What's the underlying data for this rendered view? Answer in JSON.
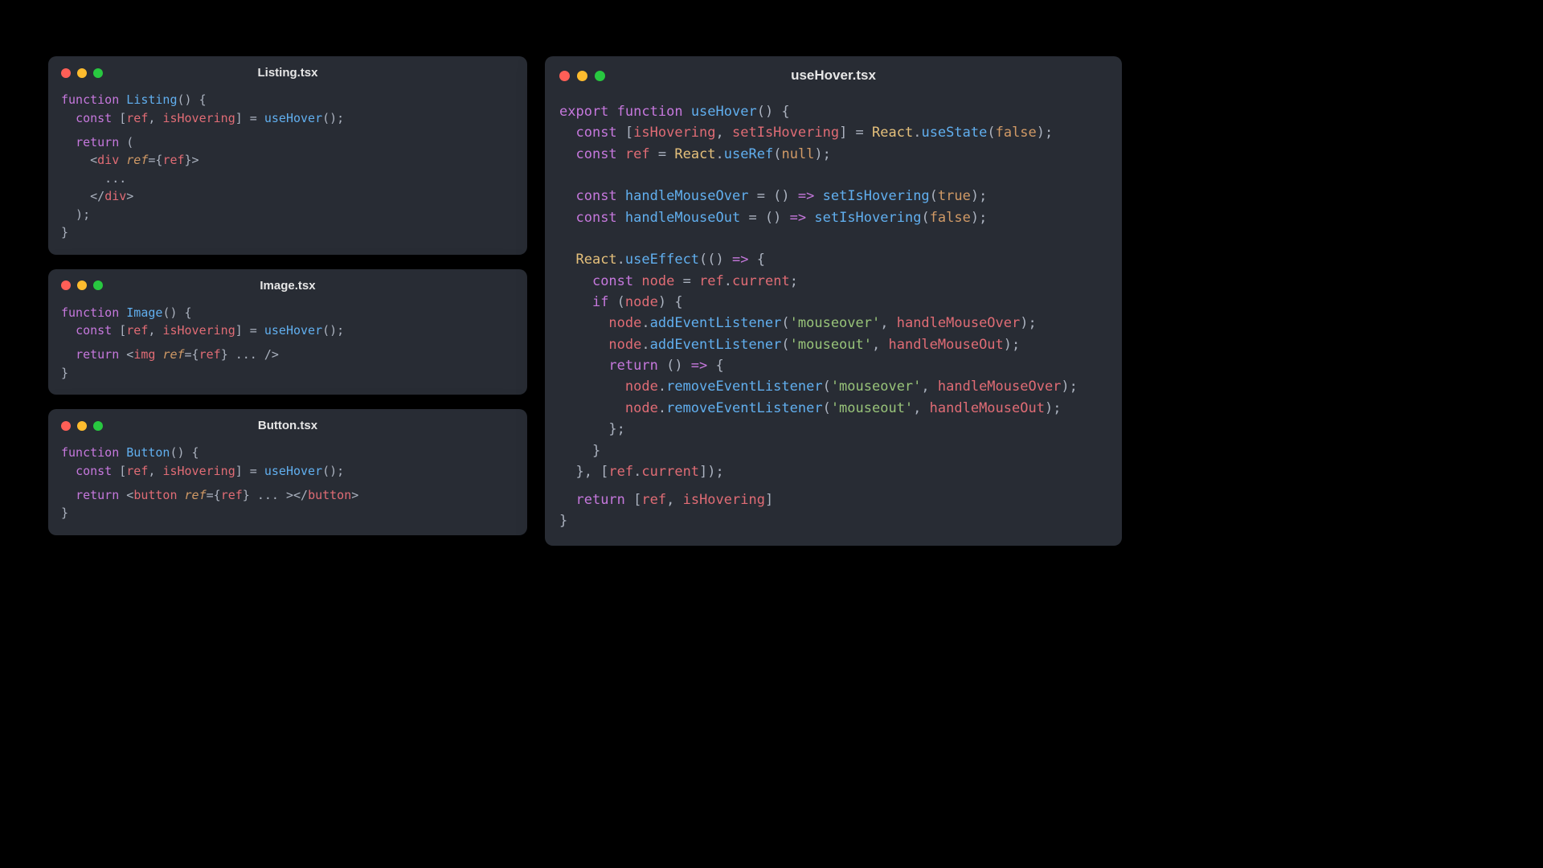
{
  "windows": {
    "listing": {
      "title": "Listing.tsx"
    },
    "image": {
      "title": "Image.tsx"
    },
    "button": {
      "title": "Button.tsx"
    },
    "useHover": {
      "title": "useHover.tsx"
    }
  },
  "code": {
    "listing": {
      "l1_kw": "function",
      "l1_fn": "Listing",
      "l1_rest": "() {",
      "l2_kw": "const",
      "l2_rest1": " [",
      "l2_ref": "ref",
      "l2_comma": ", ",
      "l2_isHov": "isHovering",
      "l2_rest2": "] = ",
      "l2_call": "useHover",
      "l2_end": "();",
      "l3_kw": "return",
      "l3_rest": " (",
      "l4_open": "<",
      "l4_tag": "div",
      "l4_sp": " ",
      "l4_attr": "ref",
      "l4_eq": "={",
      "l4_val": "ref",
      "l4_close": "}>",
      "l5": "      ...",
      "l6_open": "</",
      "l6_tag": "div",
      "l6_close": ">",
      "l7": "  );",
      "l8": "}"
    },
    "image": {
      "l1_kw": "function",
      "l1_fn": "Image",
      "l1_rest": "() {",
      "l2_kw": "const",
      "l2_rest1": " [",
      "l2_ref": "ref",
      "l2_comma": ", ",
      "l2_isHov": "isHovering",
      "l2_rest2": "] = ",
      "l2_call": "useHover",
      "l2_end": "();",
      "l3_kw": "return",
      "l3_sp": " ",
      "l3_open": "<",
      "l3_tag": "img",
      "l3_sp2": " ",
      "l3_attr": "ref",
      "l3_eq": "={",
      "l3_val": "ref",
      "l3_rest": "} ... />",
      "l4": "}"
    },
    "button": {
      "l1_kw": "function",
      "l1_fn": "Button",
      "l1_rest": "() {",
      "l2_kw": "const",
      "l2_rest1": " [",
      "l2_ref": "ref",
      "l2_comma": ", ",
      "l2_isHov": "isHovering",
      "l2_rest2": "] = ",
      "l2_call": "useHover",
      "l2_end": "();",
      "l3_kw": "return",
      "l3_sp": " ",
      "l3_open": "<",
      "l3_tag": "button",
      "l3_sp2": " ",
      "l3_attr": "ref",
      "l3_eq": "={",
      "l3_val": "ref",
      "l3_rest": "} ... >",
      "l3_close_open": "</",
      "l3_close_tag": "button",
      "l3_close_end": ">",
      "l4": "}"
    },
    "useHover": {
      "l1_export": "export",
      "l1_function": "function",
      "l1_fn": "useHover",
      "l1_rest": "() {",
      "l2_const": "const",
      "l2_a": " [",
      "l2_isHov": "isHovering",
      "l2_c": ", ",
      "l2_setHov": "setIsHovering",
      "l2_b": "] = ",
      "l2_React": "React",
      "l2_dot": ".",
      "l2_useState": "useState",
      "l2_p1": "(",
      "l2_false": "false",
      "l2_p2": ");",
      "l3_const": "const",
      "l3_sp": " ",
      "l3_ref": "ref",
      "l3_eq": " = ",
      "l3_React": "React",
      "l3_dot": ".",
      "l3_useRef": "useRef",
      "l3_p1": "(",
      "l3_null": "null",
      "l3_p2": ");",
      "l4_const": "const",
      "l4_sp": " ",
      "l4_name": "handleMouseOver",
      "l4_eq": " = () ",
      "l4_arrow": "=>",
      "l4_sp2": " ",
      "l4_call": "setIsHovering",
      "l4_p1": "(",
      "l4_true": "true",
      "l4_p2": ");",
      "l5_const": "const",
      "l5_sp": " ",
      "l5_name": "handleMouseOut",
      "l5_eq": " = () ",
      "l5_arrow": "=>",
      "l5_sp2": " ",
      "l5_call": "setIsHovering",
      "l5_p1": "(",
      "l5_false": "false",
      "l5_p2": ");",
      "l6_React": "React",
      "l6_dot": ".",
      "l6_useEffect": "useEffect",
      "l6_p1": "(() ",
      "l6_arrow": "=>",
      "l6_p2": " {",
      "l7_const": "const",
      "l7_sp": " ",
      "l7_node": "node",
      "l7_eq": " = ",
      "l7_ref": "ref",
      "l7_dot": ".",
      "l7_current": "current",
      "l7_end": ";",
      "l8_if": "if",
      "l8_rest": " (",
      "l8_node": "node",
      "l8_end": ") {",
      "l9_node": "node",
      "l9_dot": ".",
      "l9_method": "addEventListener",
      "l9_p1": "(",
      "l9_str": "'mouseover'",
      "l9_c": ", ",
      "l9_handler": "handleMouseOver",
      "l9_p2": ");",
      "l10_node": "node",
      "l10_dot": ".",
      "l10_method": "addEventListener",
      "l10_p1": "(",
      "l10_str": "'mouseout'",
      "l10_c": ", ",
      "l10_handler": "handleMouseOut",
      "l10_p2": ");",
      "l11_return": "return",
      "l11_rest": " () ",
      "l11_arrow": "=>",
      "l11_end": " {",
      "l12_node": "node",
      "l12_dot": ".",
      "l12_method": "removeEventListener",
      "l12_p1": "(",
      "l12_str": "'mouseover'",
      "l12_c": ", ",
      "l12_handler": "handleMouseOver",
      "l12_p2": ");",
      "l13_node": "node",
      "l13_dot": ".",
      "l13_method": "removeEventListener",
      "l13_p1": "(",
      "l13_str": "'mouseout'",
      "l13_c": ", ",
      "l13_handler": "handleMouseOut",
      "l13_p2": ");",
      "l14": "      };",
      "l15": "    }",
      "l16_a": "  }, [",
      "l16_ref": "ref",
      "l16_dot": ".",
      "l16_current": "current",
      "l16_b": "]);",
      "l17_return": "return",
      "l17_sp": " [",
      "l17_ref": "ref",
      "l17_c": ", ",
      "l17_isHov": "isHovering",
      "l17_end": "]",
      "l18": "}"
    }
  }
}
